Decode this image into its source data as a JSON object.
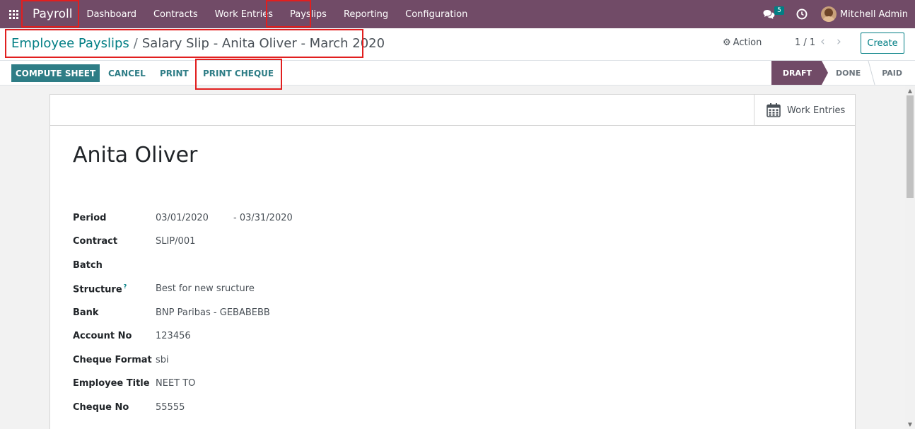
{
  "navbar": {
    "brand": "Payroll",
    "menu": [
      "Dashboard",
      "Contracts",
      "Work Entries",
      "Payslips",
      "Reporting",
      "Configuration"
    ],
    "chat_count": "5",
    "username": "Mitchell Admin"
  },
  "control_panel": {
    "breadcrumb_parent": "Employee Payslips",
    "breadcrumb_separator": "/",
    "breadcrumb_current": "Salary Slip - Anita Oliver - March 2020",
    "action_label": "Action",
    "pager": "1 / 1",
    "create_label": "Create"
  },
  "statusbar": {
    "compute_label": "COMPUTE SHEET",
    "cancel_label": "CANCEL",
    "print_label": "PRINT",
    "print_cheque_label": "PRINT CHEQUE",
    "stages": [
      "DRAFT",
      "DONE",
      "PAID"
    ],
    "active_stage": "DRAFT"
  },
  "sheet": {
    "smart_button_label": "Work Entries",
    "employee_name": "Anita Oliver",
    "fields": {
      "period_label": "Period",
      "period_from": "03/01/2020",
      "period_to": "- 03/31/2020",
      "contract_label": "Contract",
      "contract_value": "SLIP/001",
      "batch_label": "Batch",
      "batch_value": "",
      "structure_label": "Structure",
      "structure_help": "?",
      "structure_value": "Best for new sructure",
      "bank_label": "Bank",
      "bank_value": "BNP Paribas - GEBABEBB",
      "account_label": "Account No",
      "account_value": "123456",
      "cheque_format_label": "Cheque Format",
      "cheque_format_value": "sbi",
      "employee_title_label": "Employee Title",
      "employee_title_value": "NEET TO",
      "cheque_no_label": "Cheque No",
      "cheque_no_value": "55555"
    }
  },
  "colors": {
    "navbar": "#714B67",
    "primary": "#017e84",
    "highlight": "#e11f1f"
  },
  "icons": [
    "apps-grid-icon",
    "chat-icon",
    "clock-icon",
    "gear-icon",
    "chevron-left-icon",
    "chevron-right-icon",
    "calendar-icon"
  ]
}
